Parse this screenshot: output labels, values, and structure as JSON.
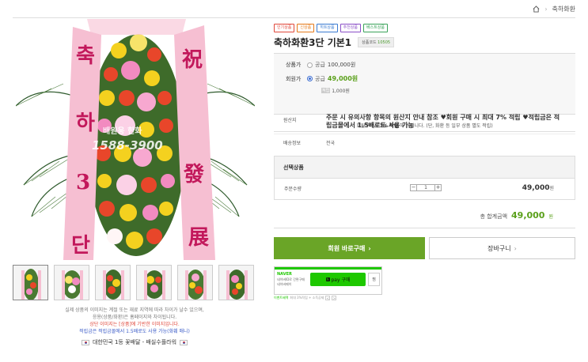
{
  "breadcrumb": {
    "current": "축하화환"
  },
  "image_caption": {
    "watermark_name": "배원웅 한화",
    "watermark_phone": "1588-3900"
  },
  "product": {
    "badges": [
      {
        "label": "인기상품",
        "color": "#e0473a"
      },
      {
        "label": "신상품",
        "color": "#e57a1a"
      },
      {
        "label": "히트상품",
        "color": "#3a7bd1"
      },
      {
        "label": "추천상품",
        "color": "#8b4fc7"
      },
      {
        "label": "베스트상품",
        "color": "#3aa35a"
      }
    ],
    "title": "축하화환3단 기본1",
    "code_label": "상품코드",
    "code": "10505"
  },
  "prices": {
    "regular_label": "상품가",
    "regular_kind": "공급",
    "regular_value": "100,000원",
    "member_label": "회원가",
    "member_kind": "공급",
    "member_value": "49,000원",
    "point_tag": "적립",
    "point_value": "1,000원"
  },
  "reward_note": {
    "prefix": "회원구매시 ",
    "rate": "7% 적립",
    "suffix": " 해 드립니다. (단, 화환 등 일부 상품 별도 적립)"
  },
  "origin": {
    "label": "원산지",
    "value": "주문 시 유의사항 항목의 원산지 안내 참조 ♥회원 구매 시 최대 7% 적립 ♥적립금은 적립금몰에서 1.5배로도 사용 가능"
  },
  "delivery": {
    "label": "배송정보",
    "value": "전국"
  },
  "options": {
    "header": "선택상품",
    "qty_label": "주문수량",
    "qty": "1",
    "minus": "−",
    "plus": "+",
    "price": "49,000",
    "price_unit": "원"
  },
  "total": {
    "label": "총 합계금액",
    "amount": "49,000",
    "unit": "원"
  },
  "buttons": {
    "buy": "회원 바로구매",
    "cart": "장바구니",
    "arrow": "›"
  },
  "naver": {
    "brand": "NAVER",
    "desc1": "네이버ID로 간편구매",
    "desc2": "네이버페이",
    "pay_label": "pay 구매",
    "pay_n": "N",
    "wish": "찜",
    "event_hl": "이벤트혜택",
    "event_text": "최대 3%적립 + 소득공제",
    "prev": "<",
    "next": ">"
  },
  "notice": {
    "line1": "실제 상품의 이미지는 계절 또는 재료 지역에 따라 차이가 날수 있으며,",
    "line1b": "응용(상품/화환)은 홈페이지와 차이됩니다.",
    "line2": "상단 이미지는 [상품]에 기반한 이미지입니다.",
    "line3": "적립금은 적립금몰에서 1.5배로도 사용 가능(화훼 매니)",
    "footer": "대한민국 1등 꽃배달 - 배실수플라워"
  }
}
